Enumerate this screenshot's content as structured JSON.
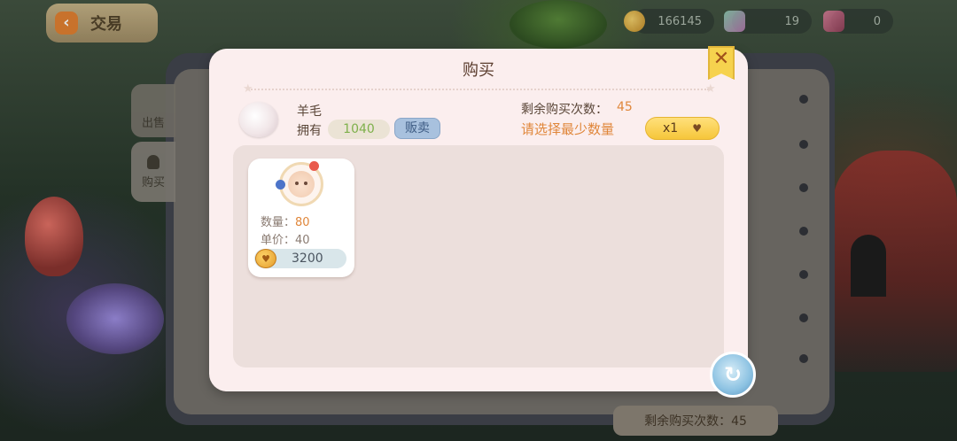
{
  "hud": {
    "back_label": "交易",
    "coins": "166145",
    "gems": "19",
    "crystals": "0"
  },
  "side_tabs": {
    "tab_other": "出售",
    "tab_buy": "购买"
  },
  "background_panel": {
    "remaining_text": "剩余购买次数：45"
  },
  "dialog": {
    "title": "购买",
    "item_name": "羊毛",
    "own_label": "拥有",
    "own_count": "1040",
    "sell_button": "贩卖",
    "remaining_label": "剩余购买次数：",
    "remaining_count": "45",
    "hint": "请选择最少数量",
    "quantity": "x1",
    "offer": {
      "qty_label": "数量：",
      "qty_value": "80",
      "unit_price_label": "单价：",
      "unit_price_value": "40",
      "total_price": "3200"
    }
  },
  "icons": {
    "back": "back-arrow-icon",
    "coin": "coin-icon",
    "gem": "gem-icon",
    "crystal": "crystal-icon",
    "close": "close-icon",
    "wool": "wool-icon",
    "avatar": "player-avatar-icon",
    "refresh": "refresh-icon",
    "heart": "heart-icon"
  },
  "colors": {
    "dialog_bg": "#fbeeee",
    "accent_orange": "#e0873b",
    "accent_green": "#7eb04b",
    "close_yellow": "#f6d24e",
    "sell_blue": "#a8c1de"
  }
}
